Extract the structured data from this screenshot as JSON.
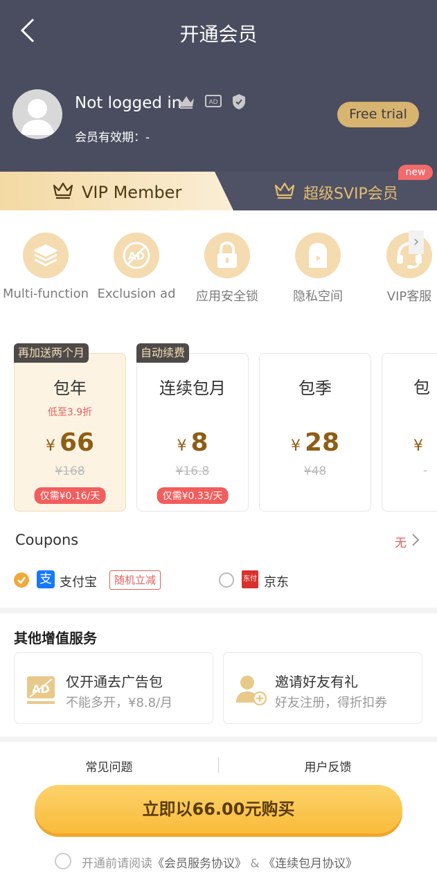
{
  "header": {
    "title": "开通会员",
    "user_name": "Not logged in",
    "validity": "会员有效期：-",
    "trial_button": "Free trial"
  },
  "tabs": {
    "vip_label": "VIP Member",
    "svip_label": "超级SVIP会员",
    "new_badge": "new"
  },
  "features": [
    {
      "label": "Multi-function",
      "icon": "layers-icon"
    },
    {
      "label": "Exclusion ad",
      "icon": "ad-block-icon"
    },
    {
      "label": "应用安全锁",
      "icon": "lock-icon"
    },
    {
      "label": "隐私空间",
      "icon": "private-space-icon"
    },
    {
      "label": "VIP客服",
      "icon": "headset-icon"
    }
  ],
  "plans": [
    {
      "tag": "再加送两个月",
      "name": "包年",
      "note": "低至3.9折",
      "currency": "¥",
      "price": "66",
      "original": "¥168",
      "daily": "仅需¥0.16/天"
    },
    {
      "tag": "自动续费",
      "name": "连续包月",
      "note": "",
      "currency": "¥",
      "price": "8",
      "original": "¥16.8",
      "daily": "仅需¥0.33/天"
    },
    {
      "tag": "",
      "name": "包季",
      "note": "",
      "currency": "¥",
      "price": "28",
      "original": "¥48",
      "daily": ""
    },
    {
      "tag": "",
      "name": "包",
      "note": "",
      "currency": "¥",
      "price": "",
      "original": "-",
      "daily": ""
    }
  ],
  "coupons": {
    "label": "Coupons",
    "value": "无"
  },
  "payment": {
    "alipay_label": "支付宝",
    "alipay_icon_text": "支",
    "alipay_promo": "随机立减",
    "jd_label": "京东",
    "jd_icon_text": "东付"
  },
  "other_services": {
    "title": "其他增值服务",
    "items": [
      {
        "title": "仅开通去广告包",
        "subtitle": "不能多开，¥8.8/月",
        "icon": "ad-icon"
      },
      {
        "title": "邀请好友有礼",
        "subtitle": "好友注册，得折扣券",
        "icon": "invite-friend-icon"
      }
    ]
  },
  "footer": {
    "faq": "常见问题",
    "feedback": "用户反馈",
    "buy_button": "立即以66.00元购买",
    "agree_prefix": "开通前请阅读",
    "agree_link1": "《会员服务协议》",
    "agree_and": " & ",
    "agree_link2": "《连续包月协议》"
  },
  "colors": {
    "header_bg": "#4a4d60",
    "gold": "#d7b46f",
    "price": "#8d5e16",
    "red": "#e35e5e"
  }
}
